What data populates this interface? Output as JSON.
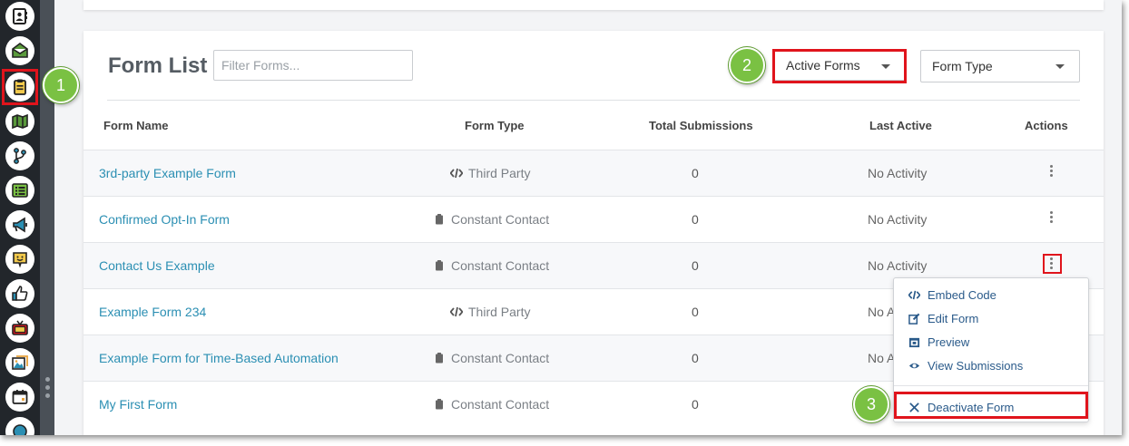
{
  "title": "Form List",
  "filter": {
    "placeholder": "Filter Forms..."
  },
  "status_select": {
    "value": "Active Forms"
  },
  "type_select": {
    "value": "Form Type"
  },
  "columns": [
    "Form Name",
    "Form Type",
    "Total Submissions",
    "Last Active",
    "Actions"
  ],
  "rows": [
    {
      "name": "3rd-party Example Form",
      "type": "Third Party",
      "type_icon": "code-icon",
      "submissions": "0",
      "last_active": "No Activity"
    },
    {
      "name": "Confirmed Opt-In Form",
      "type": "Constant Contact",
      "type_icon": "clipboard-icon",
      "submissions": "0",
      "last_active": "No Activity"
    },
    {
      "name": "Contact Us Example",
      "type": "Constant Contact",
      "type_icon": "clipboard-icon",
      "submissions": "0",
      "last_active": "No Activity"
    },
    {
      "name": "Example Form 234",
      "type": "Third Party",
      "type_icon": "code-icon",
      "submissions": "0",
      "last_active": "No A"
    },
    {
      "name": "Example Form for Time-Based Automation",
      "type": "Constant Contact",
      "type_icon": "clipboard-icon",
      "submissions": "0",
      "last_active": "No A"
    },
    {
      "name": "My First Form",
      "type": "Constant Contact",
      "type_icon": "clipboard-icon",
      "submissions": "0",
      "last_active": ""
    }
  ],
  "actions_menu": {
    "items": [
      "Embed Code",
      "Edit Form",
      "Preview",
      "View Submissions"
    ],
    "danger_item": "Deactivate Form"
  },
  "steps": [
    "1",
    "2",
    "3"
  ],
  "sidebar_icons": [
    "contacts-icon",
    "email-icon",
    "forms-icon",
    "map-icon",
    "automation-icon",
    "lists-icon",
    "megaphone-icon",
    "chat-icon",
    "thumbs-up-icon",
    "tv-icon",
    "images-icon",
    "calendar-icon",
    "more-icon"
  ],
  "colors": {
    "accent_link": "#2b8fb3",
    "highlight": "#e0141c",
    "step_badge": "#7ac143",
    "sidebar": "#22262b"
  }
}
